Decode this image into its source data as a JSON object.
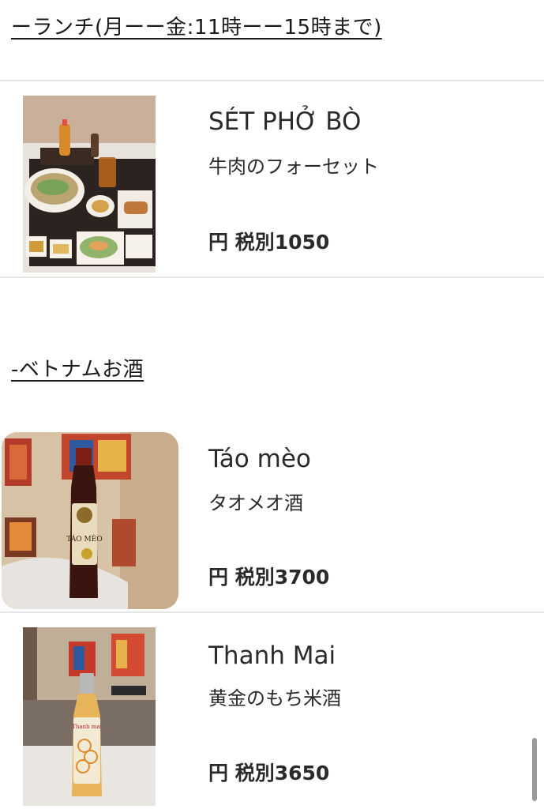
{
  "sections": [
    {
      "heading": "ーランチ(月ーー金:11時ーー15時まで)",
      "items": [
        {
          "name": "SÉT PHỞ BÒ",
          "subtitle": "牛肉のフォーセット",
          "price": "円 税別1050",
          "image_icon": "pho-set-photo-icon"
        }
      ]
    },
    {
      "heading": "-ベトナムお酒",
      "items": [
        {
          "name": "Táo mèo",
          "subtitle": "タオメオ酒",
          "price": "円 税別3700",
          "image_icon": "tao-meo-bottle-photo-icon",
          "bottle_label": "TÁO MÈO"
        },
        {
          "name": "Thanh Mai",
          "subtitle": "黄金のもち米酒",
          "price": "円 税別3650",
          "image_icon": "thanh-mai-bottle-photo-icon",
          "bottle_label": "Thanh mai"
        }
      ]
    }
  ],
  "colors": {
    "background": "#ffffff",
    "text": "#2a2a2a",
    "divider": "#e6e6e6",
    "scrollbar": "#9a9a9a"
  }
}
